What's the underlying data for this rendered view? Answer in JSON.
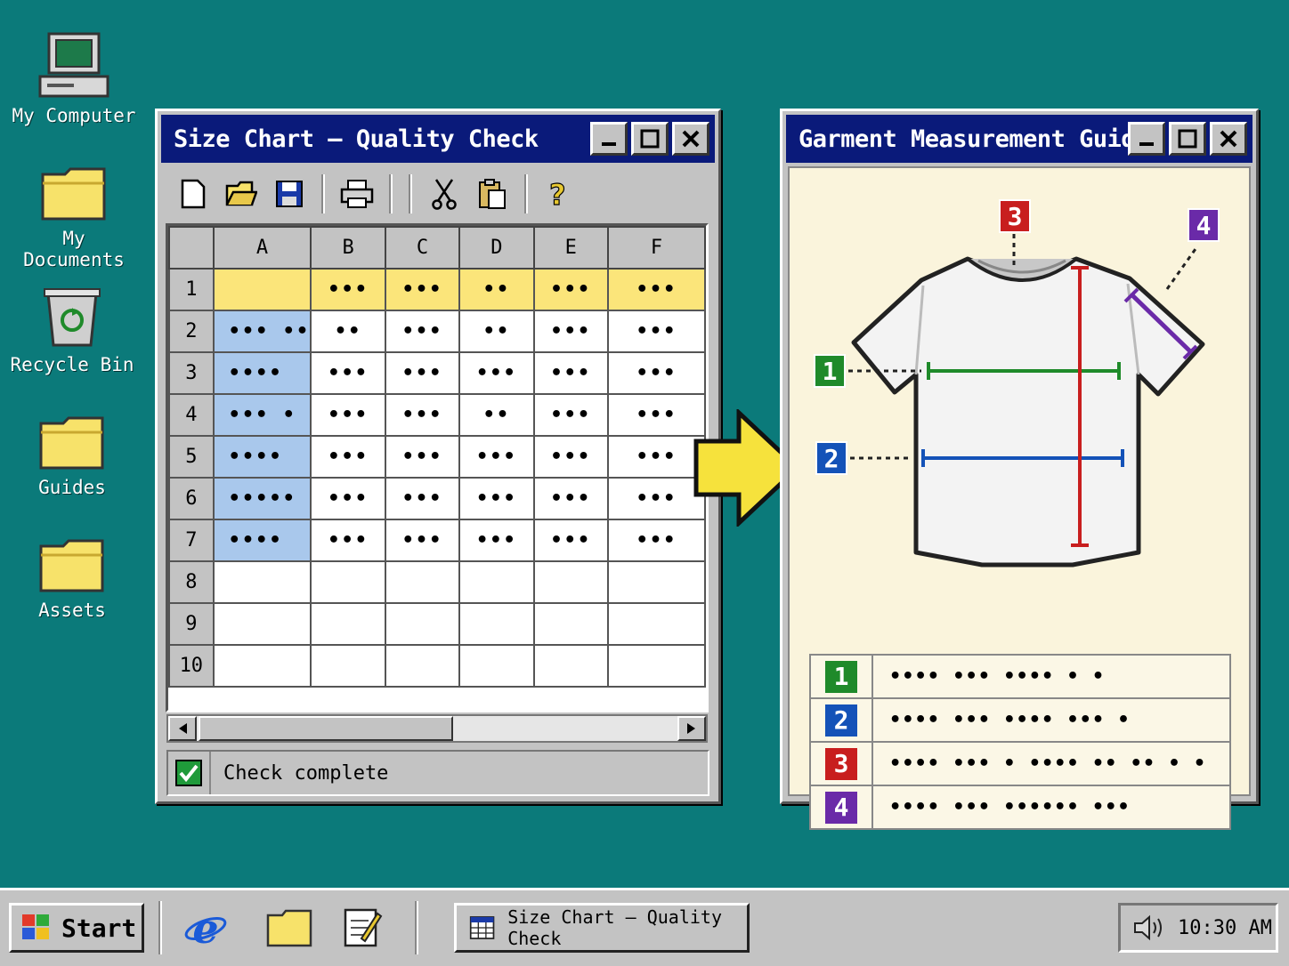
{
  "desktop": {
    "icons": [
      {
        "label": "My Computer",
        "icon": "computer-icon"
      },
      {
        "label": "My Documents",
        "icon": "folder-icon"
      },
      {
        "label": "Recycle Bin",
        "icon": "recycle-bin-icon"
      },
      {
        "label": "Guides",
        "icon": "folder-icon"
      },
      {
        "label": "Assets",
        "icon": "folder-icon"
      }
    ]
  },
  "sheet_window": {
    "title": "Size Chart – Quality Check",
    "toolbar": [
      "new-file-icon",
      "open-folder-icon",
      "save-icon",
      "print-icon",
      "cut-icon",
      "paste-icon",
      "help-icon"
    ],
    "columns": [
      "A",
      "B",
      "C",
      "D",
      "E",
      "F"
    ],
    "rows": [
      {
        "n": "1",
        "cells": [
          "",
          "•••",
          "•••",
          "••",
          "•••",
          "•••"
        ]
      },
      {
        "n": "2",
        "cells": [
          "••• ••",
          "••",
          "•••",
          "••",
          "•••",
          "•••"
        ]
      },
      {
        "n": "3",
        "cells": [
          "••••",
          "•••",
          "•••",
          "•••",
          "•••",
          "•••"
        ]
      },
      {
        "n": "4",
        "cells": [
          "••• •",
          "•••",
          "•••",
          "••",
          "•••",
          "•••"
        ]
      },
      {
        "n": "5",
        "cells": [
          "••••",
          "•••",
          "•••",
          "•••",
          "•••",
          "•••"
        ]
      },
      {
        "n": "6",
        "cells": [
          "•••••",
          "•••",
          "•••",
          "•••",
          "•••",
          "•••"
        ]
      },
      {
        "n": "7",
        "cells": [
          "••••",
          "•••",
          "•••",
          "•••",
          "•••",
          "•••"
        ]
      },
      {
        "n": "8",
        "cells": [
          "",
          "",
          "",
          "",
          "",
          ""
        ]
      },
      {
        "n": "9",
        "cells": [
          "",
          "",
          "",
          "",
          "",
          ""
        ]
      },
      {
        "n": "10",
        "cells": [
          "",
          "",
          "",
          "",
          "",
          ""
        ]
      }
    ],
    "status": "Check complete"
  },
  "guide_window": {
    "title": "Garment Measurement Guide",
    "markers": [
      {
        "num": "1",
        "color": "#1f8a2a"
      },
      {
        "num": "2",
        "color": "#1452b8"
      },
      {
        "num": "3",
        "color": "#c81e1e"
      },
      {
        "num": "4",
        "color": "#6a2aa8"
      }
    ],
    "legend": [
      {
        "num": "1",
        "desc": "••••  ••• •••• • •"
      },
      {
        "num": "2",
        "desc": "••••  ••• ••••  ••• •"
      },
      {
        "num": "3",
        "desc": "••••  ••• • •••• •• •• • •"
      },
      {
        "num": "4",
        "desc": "••••  ••• •••••• •••"
      }
    ]
  },
  "taskbar": {
    "start_label": "Start",
    "task_label": "Size Chart – Quality Check",
    "clock": "10:30 AM"
  },
  "colors": {
    "desktop": "#0b7a7a",
    "titlebar": "#0a1a7a",
    "row_highlight": "#fbe57a",
    "col_highlight": "#a9c8ec",
    "arrow": "#f6e23c"
  }
}
